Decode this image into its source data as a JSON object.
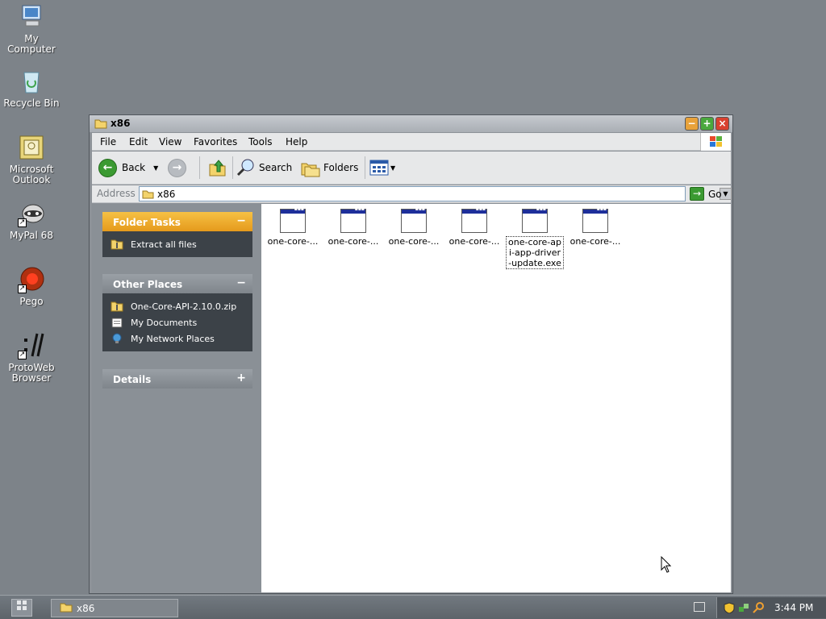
{
  "desktop": {
    "icons": [
      {
        "label": "My Computer"
      },
      {
        "label": "Recycle Bin"
      },
      {
        "label": "Microsoft Outlook"
      },
      {
        "label": "MyPal 68"
      },
      {
        "label": "Pego"
      },
      {
        "label": "ProtoWeb Browser"
      }
    ]
  },
  "window": {
    "title": "x86",
    "menu": [
      "File",
      "Edit",
      "View",
      "Favorites",
      "Tools",
      "Help"
    ],
    "toolbar": {
      "back": "Back",
      "search": "Search",
      "folders": "Folders"
    },
    "address": {
      "label": "Address",
      "value": "x86",
      "go": "Go"
    },
    "folder_tasks": {
      "title": "Folder Tasks",
      "toggle": "−",
      "links": [
        "Extract all files"
      ]
    },
    "other_places": {
      "title": "Other Places",
      "toggle": "−",
      "links": [
        "One-Core-API-2.10.0.zip",
        "My Documents",
        "My Network Places"
      ]
    },
    "details": {
      "title": "Details",
      "toggle": "+"
    },
    "files": [
      {
        "name": "one-core-..."
      },
      {
        "name": "one-core-..."
      },
      {
        "name": "one-core-..."
      },
      {
        "name": "one-core-..."
      },
      {
        "name": "one-core-ap i-app-driver -update.exe",
        "selected": true
      },
      {
        "name": "one-core-..."
      }
    ]
  },
  "taskbar": {
    "task": "x86",
    "clock": "3:44 PM"
  },
  "colors": {
    "desktop": "#7d8389",
    "folder_tasks_header": "#f0ad2c",
    "back_button": "#3b9a32"
  }
}
